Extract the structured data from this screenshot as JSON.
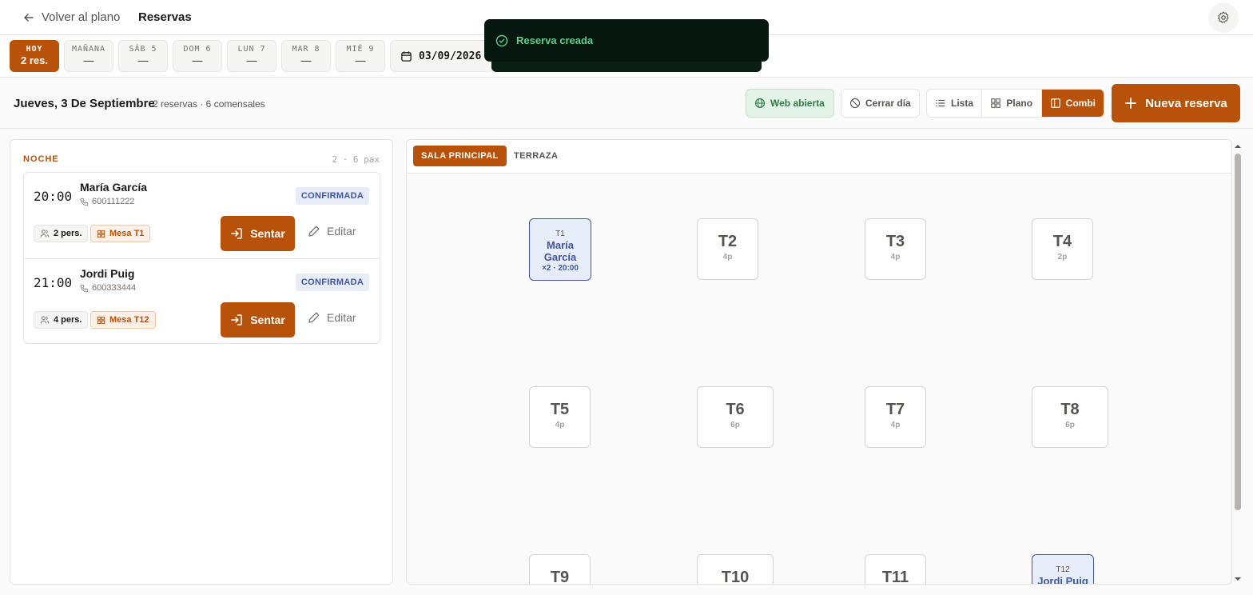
{
  "topbar": {
    "back_label": "Volver al plano",
    "page_title": "Reservas"
  },
  "days": [
    {
      "label": "HOY",
      "value": "2 res.",
      "active": true
    },
    {
      "label": "MAÑANA",
      "value": "—"
    },
    {
      "label": "SÁB 5",
      "value": "—"
    },
    {
      "label": "DOM 6",
      "value": "—"
    },
    {
      "label": "LUN 7",
      "value": "—"
    },
    {
      "label": "MAR 8",
      "value": "—"
    },
    {
      "label": "MIÉ 9",
      "value": "—"
    }
  ],
  "datepicker": {
    "value": "03/09/2026"
  },
  "toast": {
    "message": "Reserva creada"
  },
  "subheader": {
    "date_title": "Jueves, 3 De Septiembre",
    "summary": "2 reservas · 6 comensales",
    "web_open": "Web abierta",
    "close_day": "Cerrar día",
    "views": [
      "Lista",
      "Plano",
      "Combi"
    ],
    "active_view": "Combi",
    "new_reservation": "Nueva reserva"
  },
  "service": {
    "label": "NOCHE",
    "count": "2 · 6 pax"
  },
  "reservations": [
    {
      "time": "20:00",
      "name": "María García",
      "phone": "600111222",
      "status": "CONFIRMADA",
      "people": "2 pers.",
      "table": "Mesa T1",
      "seat_label": "Sentar",
      "edit_label": "Editar"
    },
    {
      "time": "21:00",
      "name": "Jordi Puig",
      "phone": "600333444",
      "status": "CONFIRMADA",
      "people": "4 pers.",
      "table": "Mesa T12",
      "seat_label": "Sentar",
      "edit_label": "Editar"
    }
  ],
  "rooms": [
    "SALA PRINCIPAL",
    "TERRAZA"
  ],
  "active_room": "SALA PRINCIPAL",
  "tables": {
    "t1": {
      "name": "T1",
      "guest": "María García",
      "info": "×2 · 20:00"
    },
    "t2": {
      "name": "T2",
      "cap": "4p"
    },
    "t3": {
      "name": "T3",
      "cap": "4p"
    },
    "t4": {
      "name": "T4",
      "cap": "2p"
    },
    "t5": {
      "name": "T5",
      "cap": "4p"
    },
    "t6": {
      "name": "T6",
      "cap": "6p"
    },
    "t7": {
      "name": "T7",
      "cap": "4p"
    },
    "t8": {
      "name": "T8",
      "cap": "6p"
    },
    "t9": {
      "name": "T9"
    },
    "t10": {
      "name": "T10"
    },
    "t11": {
      "name": "T11"
    },
    "t12": {
      "name": "T12",
      "guest": "Jordi Puig"
    }
  },
  "colors": {
    "accent": "#b8520b",
    "booked": "#3f57a3",
    "web_open": "#2f7d45"
  },
  "icons": [
    "arrow-left-icon",
    "gear-icon",
    "calendar-icon",
    "check-circle-icon",
    "globe-icon",
    "ban-icon",
    "list-icon",
    "grid-icon",
    "columns-icon",
    "plus-icon",
    "phone-icon",
    "users-icon",
    "table-icon",
    "sign-in-icon",
    "pencil-icon"
  ]
}
